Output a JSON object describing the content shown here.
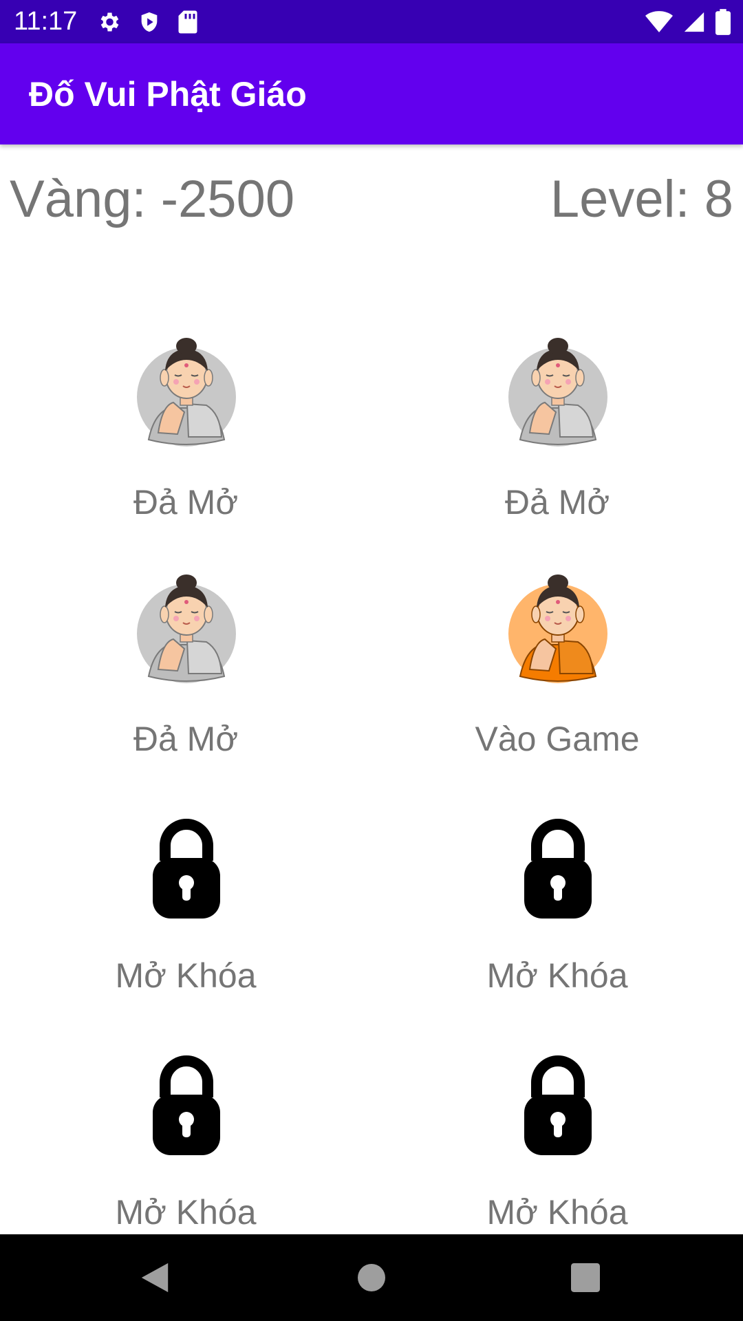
{
  "status_bar": {
    "time": "11:17",
    "left_icons": [
      "gear-icon",
      "shield-icon",
      "sd-card-icon"
    ],
    "right_icons": [
      "wifi-icon",
      "signal-icon",
      "battery-icon"
    ]
  },
  "app_bar": {
    "title": "Đố Vui Phật Giáo"
  },
  "stats": {
    "gold": "Vàng: -2500",
    "level": "Level: 8"
  },
  "levels": [
    {
      "label": "Đả Mở",
      "state": "opened",
      "icon": "buddha-gray-icon"
    },
    {
      "label": "Đả Mở",
      "state": "opened",
      "icon": "buddha-gray-icon"
    },
    {
      "label": "Đả Mở",
      "state": "opened",
      "icon": "buddha-gray-icon"
    },
    {
      "label": "Vào Game",
      "state": "current",
      "icon": "buddha-orange-icon"
    },
    {
      "label": "Mở Khóa",
      "state": "locked",
      "icon": "lock-icon"
    },
    {
      "label": "Mở Khóa",
      "state": "locked",
      "icon": "lock-icon"
    },
    {
      "label": "Mở Khóa",
      "state": "locked",
      "icon": "lock-icon"
    },
    {
      "label": "Mở Khóa",
      "state": "locked",
      "icon": "lock-icon"
    }
  ],
  "colors": {
    "status_bar": "#3700b3",
    "app_bar": "#6200ee",
    "text_gray": "#757575",
    "buddha_gray_bg": "#c8c8c8",
    "buddha_orange_bg": "#ffb56b",
    "robe_orange": "#f57c00"
  },
  "nav_bar": {
    "buttons": [
      "back-icon",
      "home-icon",
      "recents-icon"
    ]
  }
}
